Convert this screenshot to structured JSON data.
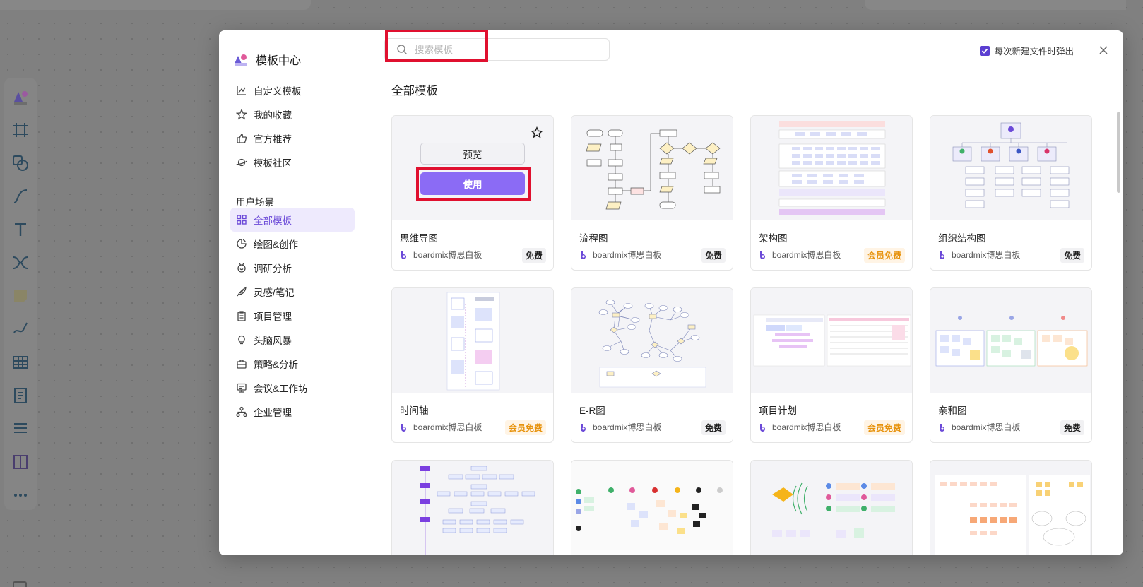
{
  "sidebar": {
    "brand_title": "模板中心",
    "top_items": [
      {
        "label": "自定义模板",
        "icon": "custom-template-icon"
      },
      {
        "label": "我的收藏",
        "icon": "star-icon"
      },
      {
        "label": "官方推荐",
        "icon": "thumbs-up-icon"
      },
      {
        "label": "模板社区",
        "icon": "planet-icon"
      }
    ],
    "section_label": "用户场景",
    "scene_items": [
      {
        "label": "全部模板",
        "icon": "grid-icon",
        "active": true
      },
      {
        "label": "绘图&创作",
        "icon": "palette-icon"
      },
      {
        "label": "调研分析",
        "icon": "survey-icon"
      },
      {
        "label": "灵感/笔记",
        "icon": "feather-icon"
      },
      {
        "label": "项目管理",
        "icon": "clipboard-icon"
      },
      {
        "label": "头脑风暴",
        "icon": "lightbulb-icon"
      },
      {
        "label": "策略&分析",
        "icon": "briefcase-icon"
      },
      {
        "label": "会议&工作坊",
        "icon": "presentation-icon"
      },
      {
        "label": "企业管理",
        "icon": "org-icon"
      }
    ]
  },
  "search": {
    "placeholder": "搜索模板",
    "value": ""
  },
  "popup_option": {
    "label": "每次新建文件时弹出",
    "checked": true
  },
  "heading": "全部模板",
  "hover_card": {
    "preview_label": "预览",
    "use_label": "使用"
  },
  "author": "boardmix博思白板",
  "cards": [
    {
      "title": "思维导图",
      "badge": "免费",
      "badge_type": "free"
    },
    {
      "title": "流程图",
      "badge": "免费",
      "badge_type": "free"
    },
    {
      "title": "架构图",
      "badge": "会员免费",
      "badge_type": "member"
    },
    {
      "title": "组织结构图",
      "badge": "免费",
      "badge_type": "free"
    },
    {
      "title": "时间轴",
      "badge": "会员免费",
      "badge_type": "member"
    },
    {
      "title": "E-R图",
      "badge": "免费",
      "badge_type": "free"
    },
    {
      "title": "项目计划",
      "badge": "会员免费",
      "badge_type": "member"
    },
    {
      "title": "亲和图",
      "badge": "免费",
      "badge_type": "free"
    },
    {
      "title": "",
      "badge": "",
      "badge_type": ""
    },
    {
      "title": "",
      "badge": "",
      "badge_type": ""
    },
    {
      "title": "",
      "badge": "",
      "badge_type": ""
    },
    {
      "title": "",
      "badge": "",
      "badge_type": ""
    }
  ],
  "colors": {
    "accent": "#6b49d8",
    "use_button": "#8b6bf5",
    "highlight_box": "#e0102f",
    "member_badge_text": "#e7930e"
  }
}
